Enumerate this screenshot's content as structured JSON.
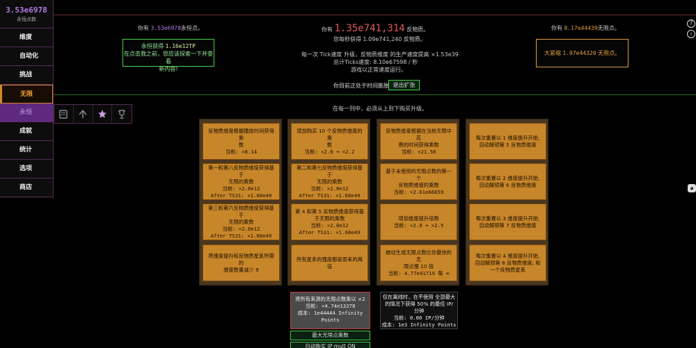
{
  "sidebar": {
    "eternity_points_value": "3.53e6978",
    "eternity_points_label": "永恒点数",
    "items": [
      {
        "label": "维度"
      },
      {
        "label": "自动化"
      },
      {
        "label": "挑战"
      },
      {
        "label": "无限"
      },
      {
        "label": "永恒"
      },
      {
        "label": "成就"
      },
      {
        "label": "统计"
      },
      {
        "label": "选项"
      },
      {
        "label": "商店"
      }
    ]
  },
  "subtabs": [
    "book-icon",
    "arrow-up-icon",
    "star-icon",
    "trophy-icon"
  ],
  "header": {
    "ep_prefix": "你有",
    "ep_value": "3.53e6978",
    "ep_suffix": "永恒点。",
    "ep_button_line1_prefix": "永恒获得",
    "ep_button_line1_value": "1.16e12TP",
    "ep_button_line2": "在点击我之前，您应该探索一下并查看",
    "ep_button_line3": "新内容!",
    "am_prefix": "你有",
    "am_value": "1.35e741,314",
    "am_suffix": "反物质。",
    "am_rate": "您每秒获得 1.09e741,240 反物质。",
    "tick_line": "每一次 Tick速度 升级，反物质维度 的生产速度提高 ×1.53e39",
    "ticks_line": "总计Ticks速度: 8.10e67598 / 秒",
    "speed_line": "游戏以正常速度运行。",
    "dilation_status": "你目前正处于时间膨胀",
    "dilation_button": "退出扩张",
    "ip_prefix": "你有",
    "ip_value": "8.17e44439",
    "ip_suffix": "无限点。",
    "infinity_button_prefix": "大紧缩",
    "infinity_button_value": "1.07e44320",
    "infinity_button_suffix": "无限点。"
  },
  "instructions": "在每一列中，必须从上到下购买升级。",
  "columns": [
    [
      {
        "lines": [
          "反物质维度根据播放时间获得乘",
          "数"
        ],
        "current": "当前: ×8.14",
        "extra": ""
      },
      {
        "lines": [
          "第一和第八反物质维度获得基于",
          "无限的乘数"
        ],
        "current": "当前: ×2.0e12",
        "extra": "After TS31: ×1.60e49"
      },
      {
        "lines": [
          "第三和第六反物质维度获得基于",
          "无限的乘数"
        ],
        "current": "当前: ×2.0e12",
        "extra": "After TS31: ×1.60e49"
      },
      {
        "lines": [
          "将维度提升和反物质星系所需的",
          "维度数量减少 9"
        ],
        "current": "",
        "extra": ""
      }
    ],
    [
      {
        "lines": [
          "增加购买 10 个反物质维度的乘",
          "数"
        ],
        "current": "当前: ×2.0 ➜ ×2.2",
        "extra": ""
      },
      {
        "lines": [
          "第二和第七反物质维度获得基于",
          "无限的乘数"
        ],
        "current": "当前: ×2.0e12",
        "extra": "After TS31: ×1.60e49"
      },
      {
        "lines": [
          "第 4 和第 5 反物质维度获得基",
          "于无限的乘数"
        ],
        "current": "当前: ×2.0e12",
        "extra": "After TS31: ×1.60e49"
      },
      {
        "lines": [
          "所有星系的强度都是原来的两倍"
        ],
        "current": "",
        "extra": ""
      }
    ],
    [
      {
        "lines": [
          "反物质维度根据在当前无限中花",
          "费的时间获得乘数"
        ],
        "current": "当前: ×21.58",
        "extra": ""
      },
      {
        "lines": [
          "基于未使用的无限点数的第一个",
          "反物质维度的乘数"
        ],
        "current": "当前: ×2.61e66659",
        "extra": ""
      },
      {
        "lines": [
          "增加维度提升倍数"
        ],
        "current": "当前: ×2.0 ➜ ×2.5",
        "extra": ""
      },
      {
        "lines": [
          "被动生成无限点数比你最快的无",
          "限点慢 10 倍"
        ],
        "current": "当前: 4.77e41719 每 ∞",
        "extra": ""
      }
    ],
    [
      {
        "lines": [
          "每次重置以 1 维度提升开始,",
          "自动解锁第 5 反物质维度"
        ],
        "current": "",
        "extra": ""
      },
      {
        "lines": [
          "每次重置以 2 维度提升开始,",
          "自动解锁第 6 反物质维度"
        ],
        "current": "",
        "extra": ""
      },
      {
        "lines": [
          "每次重置以 3 维度提升开始,",
          "自动解锁第 7 反物质维度"
        ],
        "current": "",
        "extra": ""
      },
      {
        "lines": [
          "每次重置以 4 维度提升开始,",
          "自动解锁第 8 反物质维度; 和",
          "一个反物质星系"
        ],
        "current": "",
        "extra": ""
      }
    ]
  ],
  "ip_mult": {
    "line1": "将所有来源的无限点数乘以 ×2",
    "current": "当前: ×4.74e13378",
    "cost": "成本: 1e44444 Infinity",
    "cost2": "Points"
  },
  "offline": {
    "line1": "仅在离线时，在不使用 全部最大",
    "line2": "的情况下获得 50% 的最佳 IP/",
    "line3": "分钟",
    "current": "当前: 0.00 IP/分钟",
    "cost": "成本: 1e3 Infinity Points"
  },
  "max_ip_button": "最大无限点乘数",
  "auto_ip_button": "自动购买 IP mult ON"
}
